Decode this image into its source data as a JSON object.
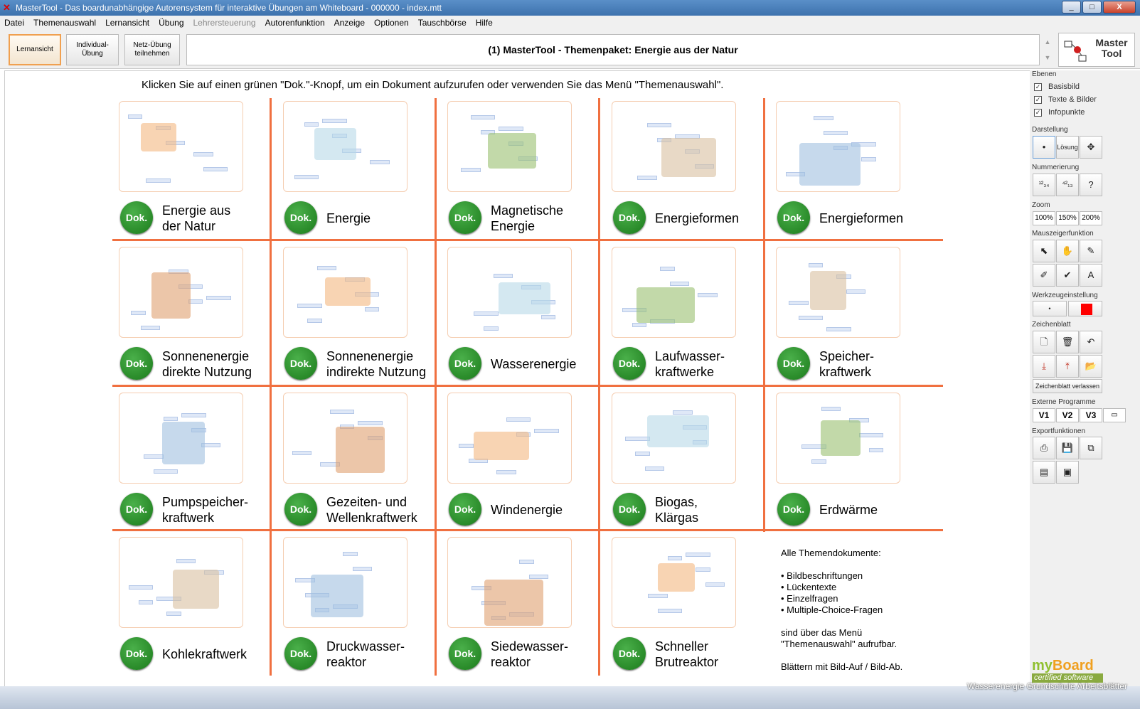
{
  "window": {
    "title": "MasterTool - Das boardunabhängige Autorensystem für interaktive Übungen am Whiteboard - 000000 - index.mtt",
    "controls": [
      "_",
      "□",
      "X"
    ]
  },
  "menu": [
    "Datei",
    "Themenauswahl",
    "Lernansicht",
    "Übung",
    "Lehrersteuerung",
    "Autorenfunktion",
    "Anzeige",
    "Optionen",
    "Tauschbörse",
    "Hilfe"
  ],
  "toolbar": {
    "lernansicht": "Lernansicht",
    "individual": "Individual-\nÜbung",
    "netz": "Netz-Übung\nteilnehmen",
    "title": "(1) MasterTool - Themenpaket: Energie aus der Natur",
    "logo": "Master\nTool"
  },
  "instruction": "Klicken Sie auf einen grünen \"Dok.\"-Knopf, um ein Dokument aufzurufen oder verwenden Sie das Menü \"Themenauswahl\".",
  "dok_label": "Dok.",
  "docs": [
    {
      "label": "Energie aus\nder Natur"
    },
    {
      "label": "Energie"
    },
    {
      "label": "Magnetische\nEnergie"
    },
    {
      "label": "Energieformen"
    },
    {
      "label": "Energieformen"
    },
    {
      "label": "Sonnenenergie\ndirekte Nutzung"
    },
    {
      "label": "Sonnenenergie\nindirekte Nutzung"
    },
    {
      "label": "Wasserenergie"
    },
    {
      "label": "Laufwasser-\nkraftwerke"
    },
    {
      "label": "Speicher-\nkraftwerk"
    },
    {
      "label": "Pumpspeicher-\nkraftwerk"
    },
    {
      "label": "Gezeiten- und\nWellenkraftwerk"
    },
    {
      "label": "Windenergie"
    },
    {
      "label": "Biogas,\nKlärgas"
    },
    {
      "label": "Erdwärme"
    },
    {
      "label": "Kohlekraftwerk"
    },
    {
      "label": "Druckwasser-\nreaktor"
    },
    {
      "label": "Siedewasser-\nreaktor"
    },
    {
      "label": "Schneller\nBrutreaktor"
    }
  ],
  "all_docs": [
    "Alle Themendokumente:",
    "",
    "• Bildbeschriftungen",
    "• Lückentexte",
    "• Einzelfragen",
    "• Multiple-Choice-Fragen",
    "",
    "sind über das Menü",
    "\"Themenauswahl\" aufrufbar.",
    "",
    "Blättern mit Bild-Auf / Bild-Ab."
  ],
  "sidebar": {
    "ebenen": "Ebenen",
    "basisbild": "Basisbild",
    "texte": "Texte & Bilder",
    "infopunkte": "Infopunkte",
    "darstellung": "Darstellung",
    "loesung": "Lösung",
    "nummerierung": "Nummerierung",
    "zoom": "Zoom",
    "zoom_levels": [
      "100%",
      "150%",
      "200%"
    ],
    "mauszeiger": "Mauszeigerfunktion",
    "werkzeug": "Werkzeugeinstellung",
    "zeichenblatt": "Zeichenblatt",
    "zeichen_verlassen": "Zeichenblatt verlassen",
    "extern": "Externe Programme",
    "v1": "V1",
    "v2": "V2",
    "v3": "V3",
    "export": "Exportfunktionen",
    "tool_color": "#ff0000"
  },
  "brand": {
    "name_a": "my",
    "name_b": "Board",
    "tagline": "certified software"
  },
  "caption": "Wasserenergie Grundschule Arbeitsblätter"
}
